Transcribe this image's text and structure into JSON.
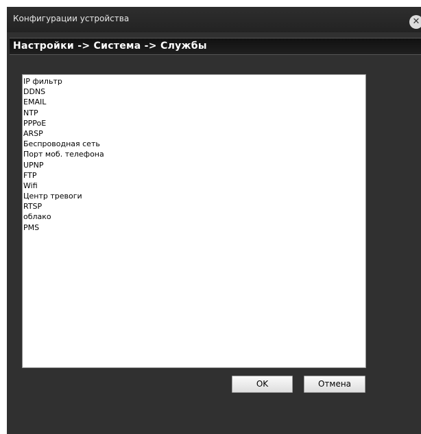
{
  "window": {
    "title": "Конфигурации устройства",
    "close_glyph": "✕"
  },
  "breadcrumb": {
    "text": "Настройки -> Система -> Службы"
  },
  "services": [
    "IP фильтр",
    "DDNS",
    "EMAIL",
    "NTP",
    "PPPoE",
    "ARSP",
    "Беспроводная сеть",
    "Порт моб. телефона",
    "UPNP",
    "FTP",
    "Wifi",
    "Центр тревоги",
    "RTSP",
    "облако",
    "PMS"
  ],
  "buttons": {
    "ok_label": "OK",
    "cancel_label": "Отмена"
  },
  "colors": {
    "window_bg": "#303030",
    "breadcrumb_bg": "#151515",
    "list_bg": "#ffffff"
  }
}
